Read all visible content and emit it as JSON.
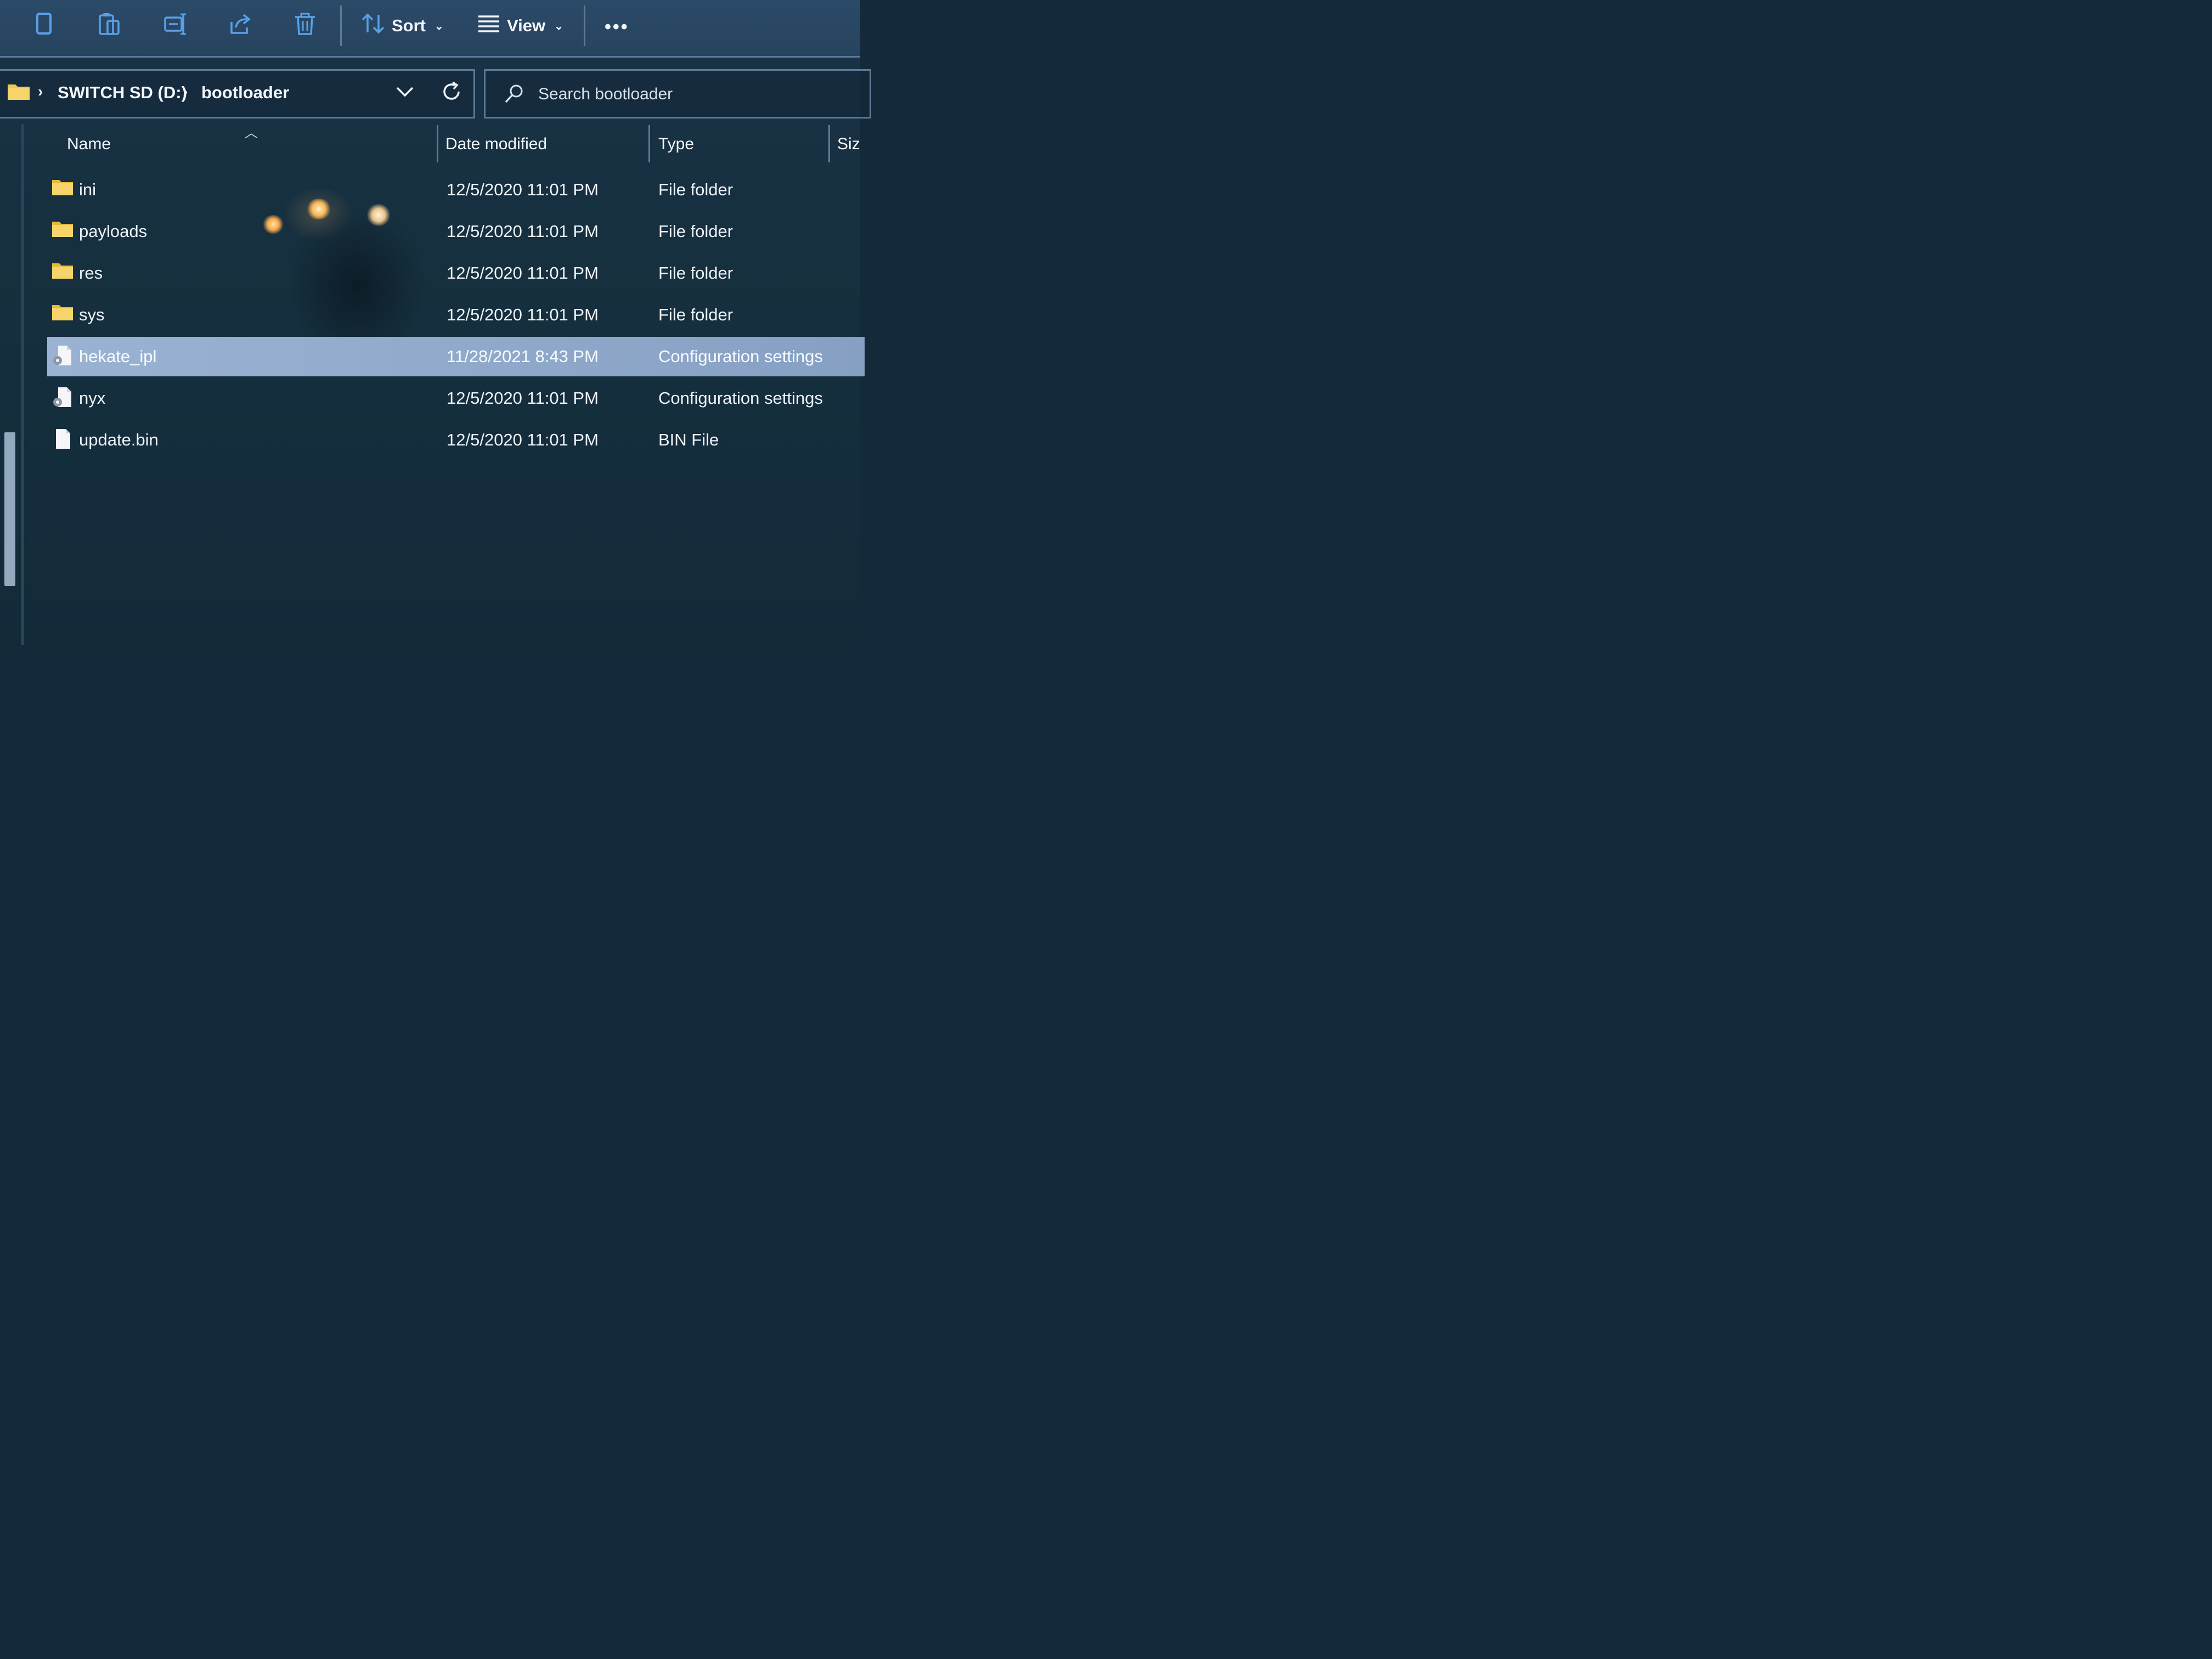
{
  "toolbar": {
    "sort_label": "Sort",
    "view_label": "View",
    "icons": [
      "copy-icon",
      "paste-icon",
      "rename-icon",
      "share-icon",
      "delete-icon",
      "sort-icon",
      "view-icon",
      "more-icon"
    ]
  },
  "address_bar": {
    "breadcrumbs": [
      "SWITCH SD (D:)",
      "bootloader"
    ]
  },
  "search": {
    "placeholder": "Search bootloader"
  },
  "columns": {
    "name": "Name",
    "date": "Date modified",
    "type": "Type",
    "size": "Size"
  },
  "files": [
    {
      "name": "ini",
      "date": "12/5/2020 11:01 PM",
      "type": "File folder",
      "icon": "folder-icon"
    },
    {
      "name": "payloads",
      "date": "12/5/2020 11:01 PM",
      "type": "File folder",
      "icon": "folder-icon"
    },
    {
      "name": "res",
      "date": "12/5/2020 11:01 PM",
      "type": "File folder",
      "icon": "folder-icon"
    },
    {
      "name": "sys",
      "date": "12/5/2020 11:01 PM",
      "type": "File folder",
      "icon": "folder-icon"
    },
    {
      "name": "hekate_ipl",
      "date": "11/28/2021 8:43 PM",
      "type": "Configuration settings",
      "icon": "config-file-icon",
      "selected": true
    },
    {
      "name": "nyx",
      "date": "12/5/2020 11:01 PM",
      "type": "Configuration settings",
      "icon": "config-file-icon"
    },
    {
      "name": "update.bin",
      "date": "12/5/2020 11:01 PM",
      "type": "BIN File",
      "icon": "file-icon"
    }
  ],
  "colors": {
    "accent": "#5aa0e6",
    "folder": "#f2c94c",
    "selection": "#9bb3d2",
    "background": "#14293a"
  }
}
